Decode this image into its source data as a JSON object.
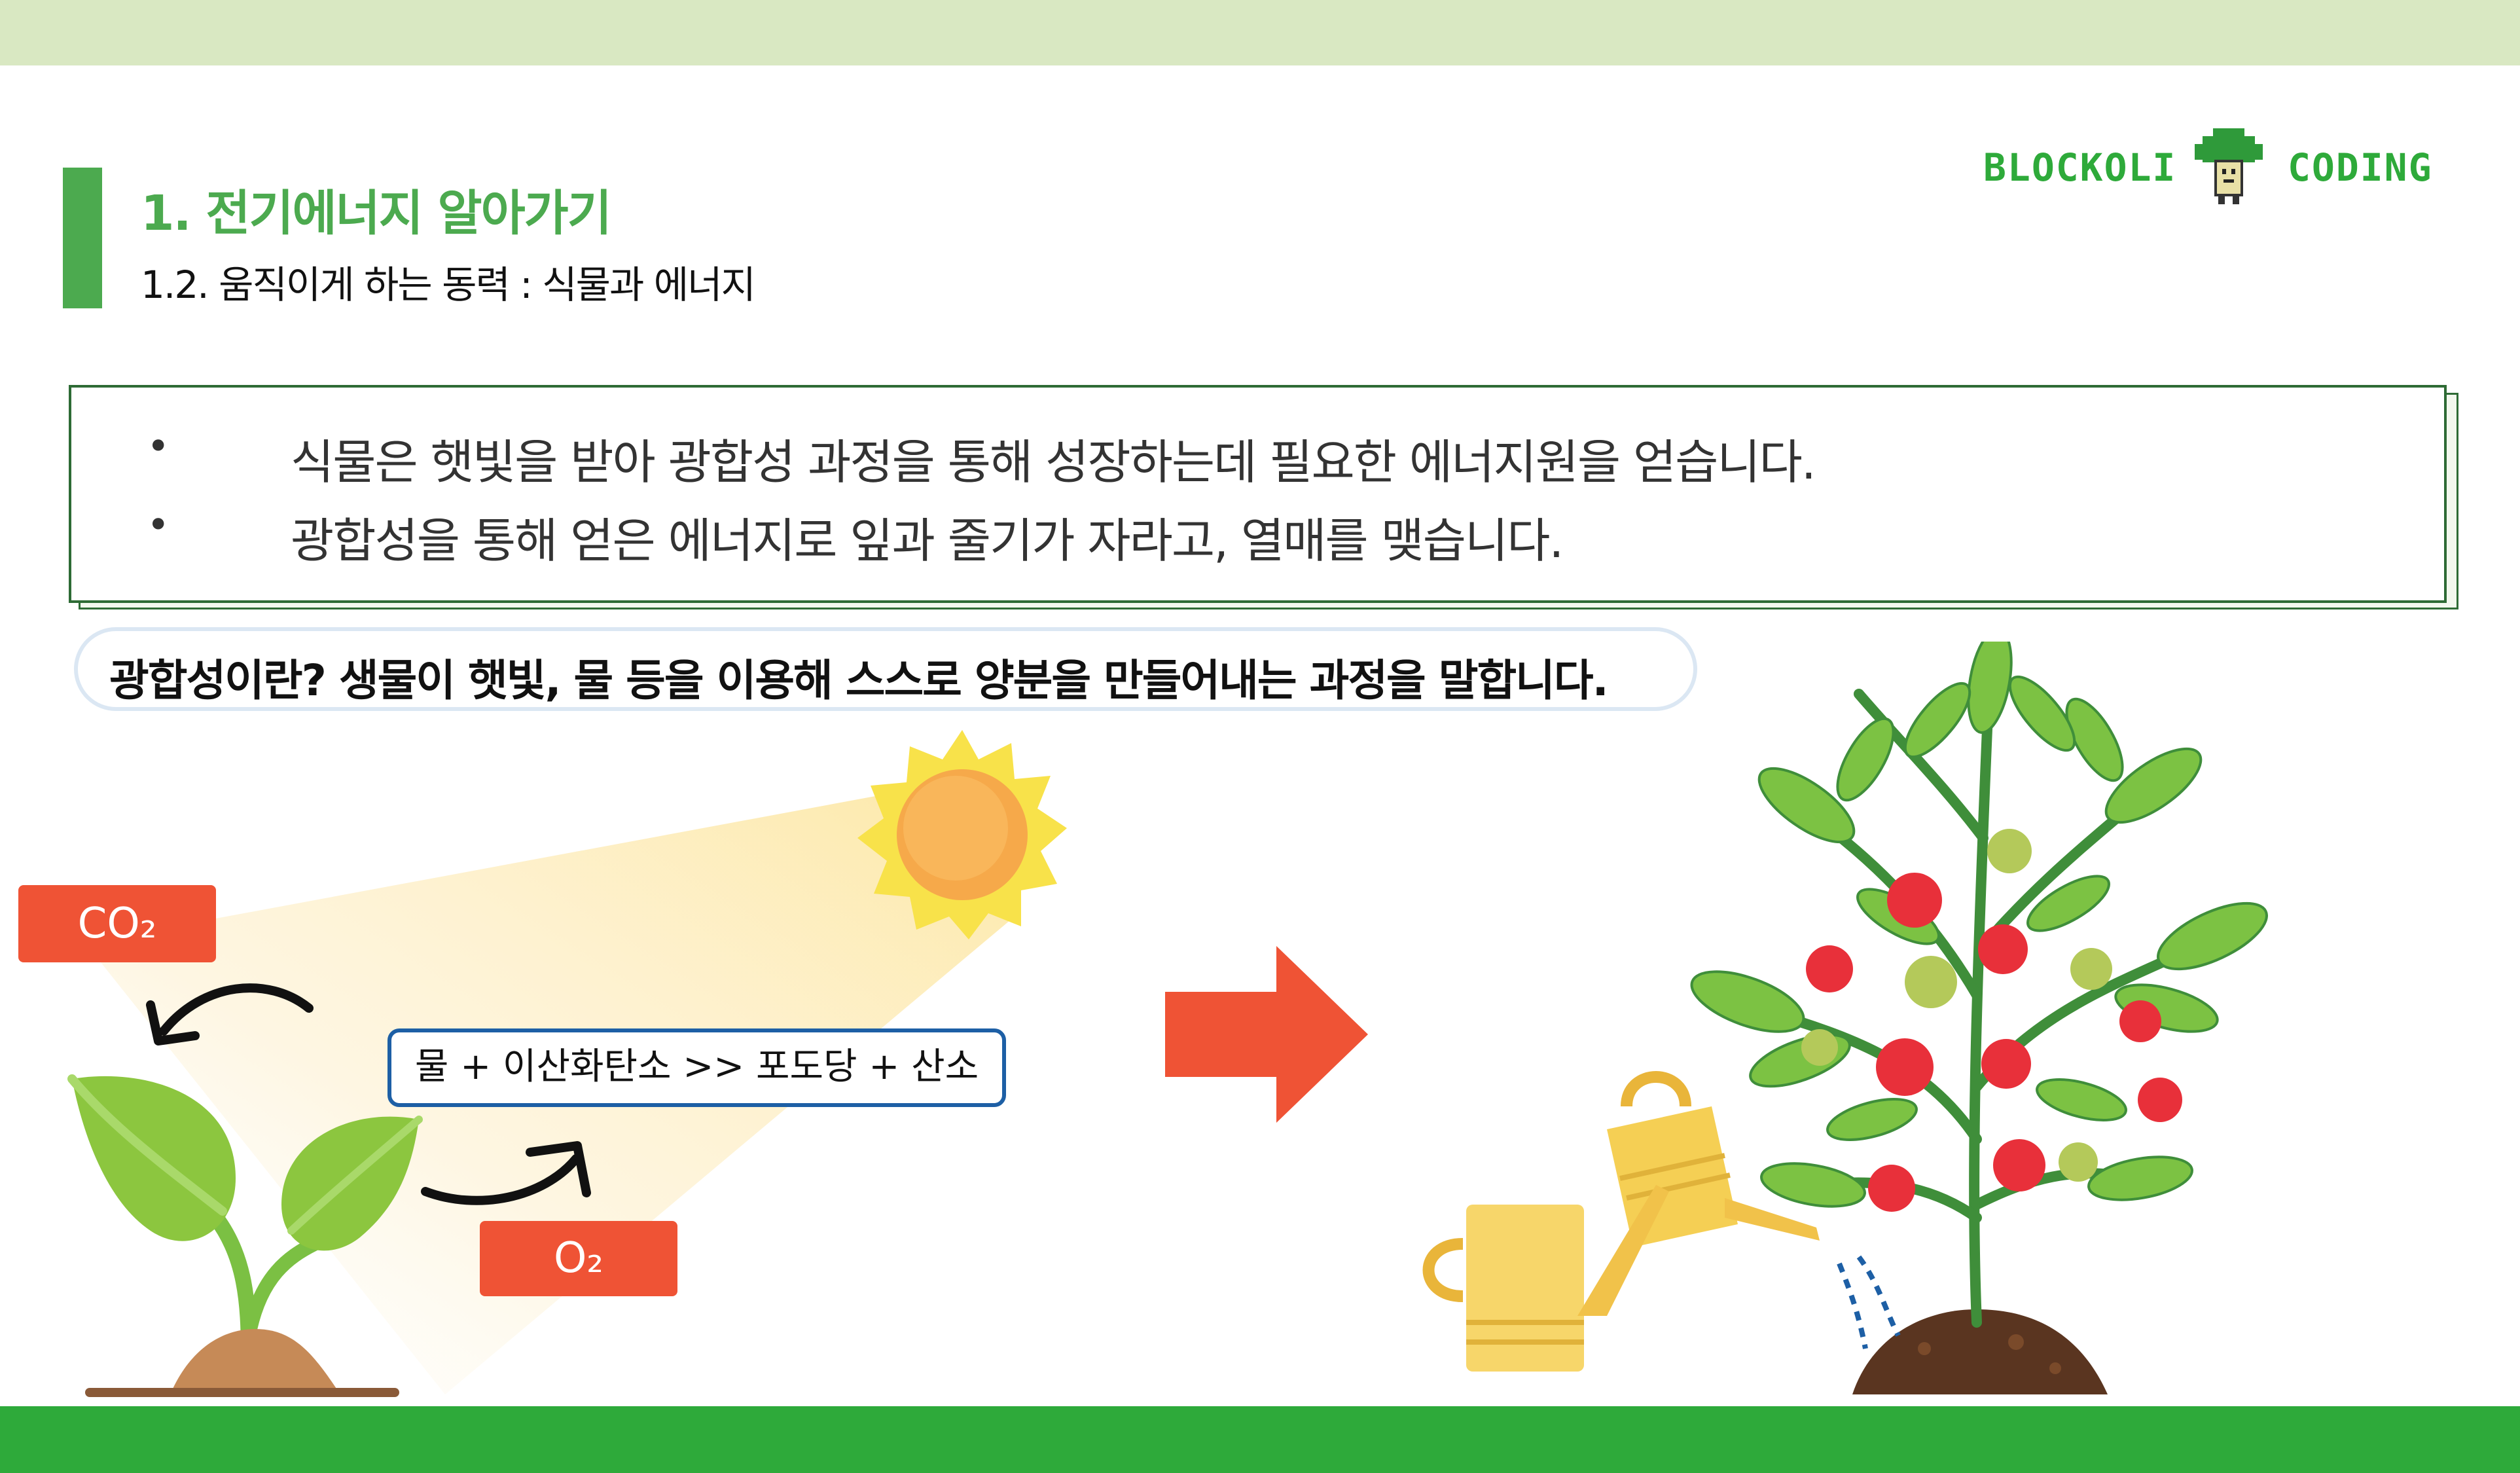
{
  "header": {
    "title": "1. 전기에너지 알아가기",
    "subtitle": "1.2. 움직이게 하는 동력 : 식물과 에너지"
  },
  "logo": {
    "left_text": "BLOCKOLI",
    "right_text": "CODING",
    "mascot_icon": "broccoli-mascot-icon"
  },
  "info": {
    "bullet_symbol": "•",
    "bullets": [
      "식물은 햇빛을 받아 광합성 과정을 통해 성장하는데 필요한 에너지원을 얻습니다.",
      "광합성을 통해 얻은 에너지로 잎과 줄기가 자라고, 열매를 맺습니다."
    ]
  },
  "definition": "광합성이란? 생물이 햇빛, 물 등을 이용해 스스로 양분을 만들어내는 과정을 말합니다.",
  "diagram": {
    "co2_label": "CO₂",
    "o2_label": "O₂",
    "formula": "물 + 이산화탄소 >> 포도당 + 산소",
    "icons": [
      "sun-icon",
      "sprout-icon",
      "arrow-right-icon",
      "watering-can-icon",
      "tomato-plant-icon"
    ]
  },
  "colors": {
    "accent_green": "#4caa4f",
    "bottom_band": "#2eaa3a",
    "top_band": "#d9e8c2",
    "label_red": "#ef5335",
    "formula_border": "#1d5fa5",
    "box_border": "#2e6b35"
  }
}
